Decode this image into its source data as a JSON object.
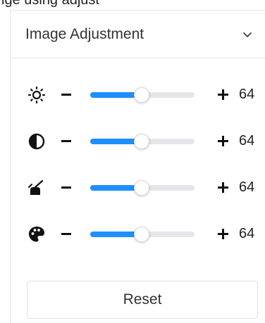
{
  "top_cutoff_text": "ige using adjust",
  "panel": {
    "title": "Image Adjustment",
    "collapse_icon": "chevron-down-icon"
  },
  "adjustments": [
    {
      "id": "brightness",
      "icon": "brightness-icon",
      "value": "64",
      "level_percent": 49
    },
    {
      "id": "contrast",
      "icon": "contrast-icon",
      "value": "64",
      "level_percent": 49
    },
    {
      "id": "saturation",
      "icon": "saturation-icon",
      "value": "64",
      "level_percent": 49
    },
    {
      "id": "hue",
      "icon": "palette-icon",
      "value": "64",
      "level_percent": 49
    }
  ],
  "reset_label": "Reset",
  "colors": {
    "accent": "#1e8fff",
    "track": "#e4e6ea",
    "border": "#e3e6ea",
    "text": "#333333"
  }
}
